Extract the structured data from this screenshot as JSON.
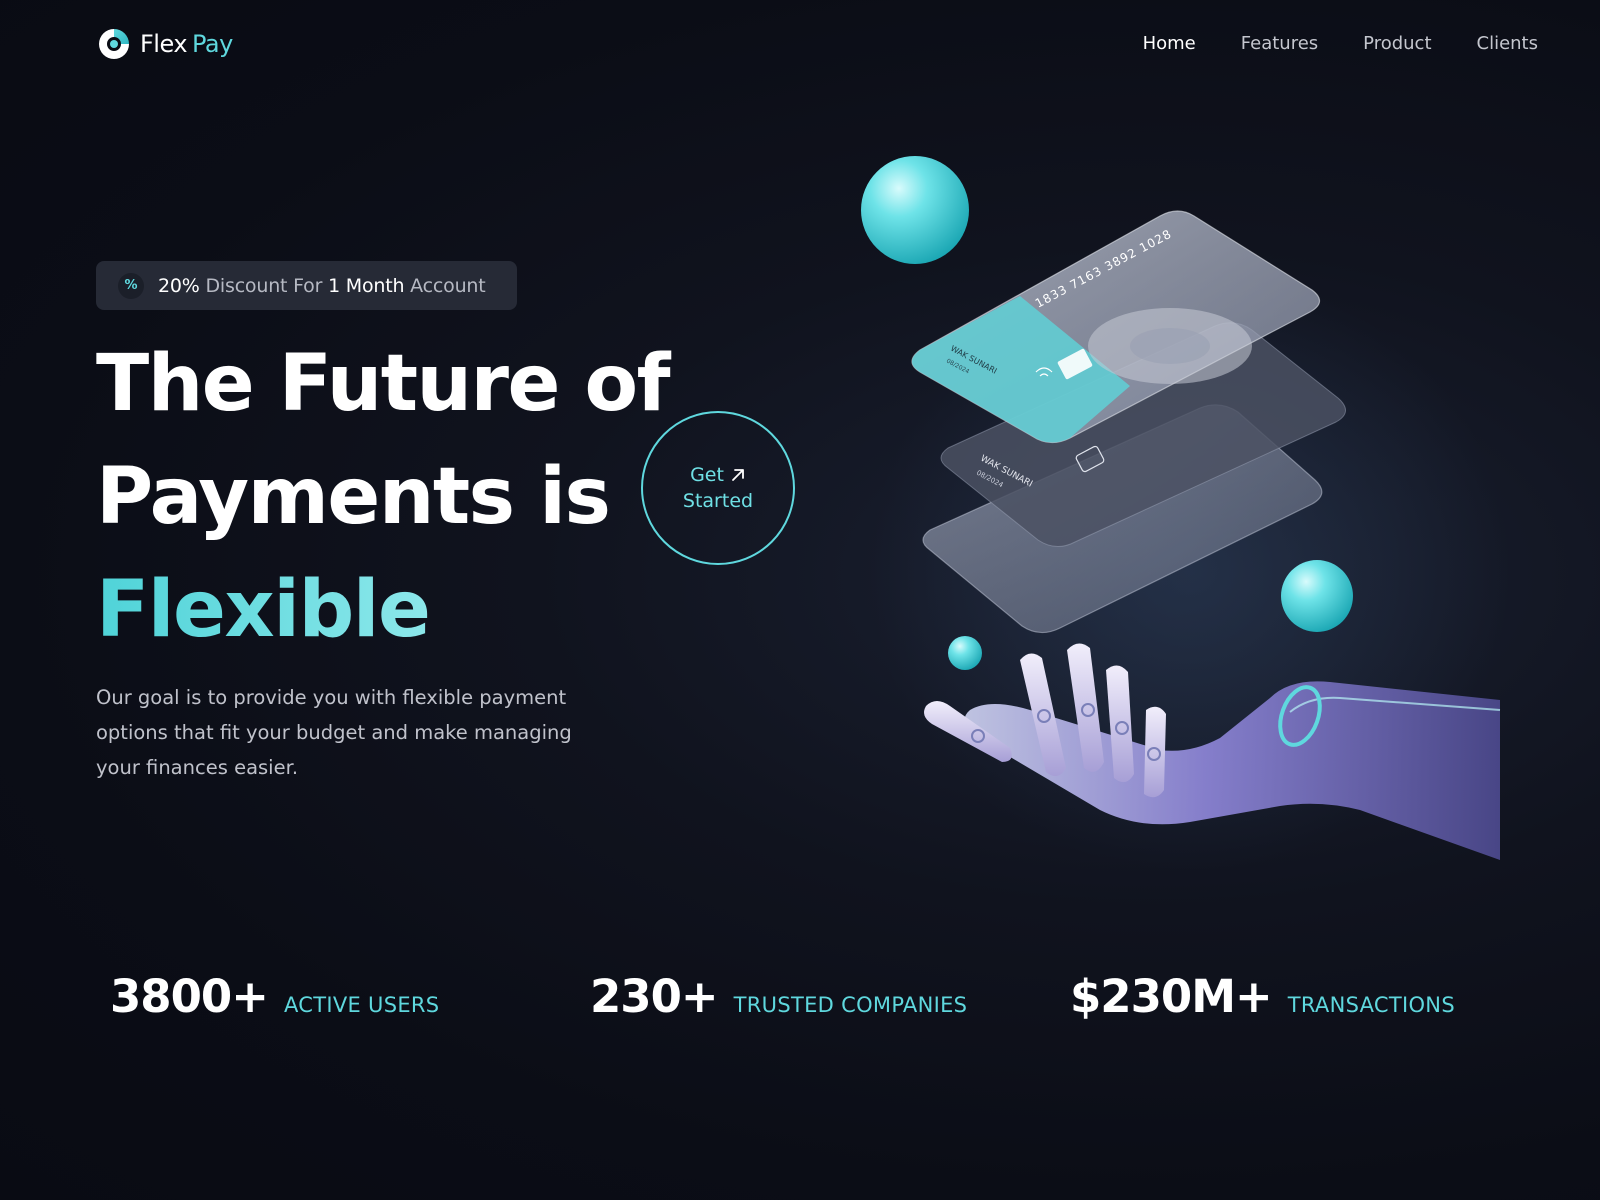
{
  "brand": {
    "name_part1": "Flex",
    "name_part2": "Pay"
  },
  "nav": {
    "items": [
      {
        "label": "Home",
        "active": true
      },
      {
        "label": "Features",
        "active": false
      },
      {
        "label": "Product",
        "active": false
      },
      {
        "label": "Clients",
        "active": false
      }
    ]
  },
  "badge": {
    "icon_glyph": "%",
    "text_parts": [
      "20%",
      " Discount For ",
      "1 Month",
      " Account"
    ]
  },
  "hero": {
    "headline_lines": [
      "The Future of",
      "Payments is",
      "Flexible"
    ],
    "cta_line1": "Get",
    "cta_line2": "Started",
    "description": "Our goal is to provide you with flexible payment options that fit your budget and make managing your finances easier."
  },
  "illustration": {
    "card_front_number": "1833 7163 3892 1028",
    "card_holder": "WAK SUNARI",
    "card_expiry": "08/2024"
  },
  "stats": [
    {
      "value": "3800+",
      "label": "ACTIVE USERS"
    },
    {
      "value": "230+",
      "label": "TRUSTED COMPANIES"
    },
    {
      "value": "$230M+",
      "label": "TRANSACTIONS"
    }
  ],
  "colors": {
    "accent": "#5fd8de",
    "background": "#0b0d16",
    "badge_bg": "#262a36",
    "text_muted": "#c0c2cb"
  },
  "icons": {
    "logo": "flexpay-logo-icon",
    "badge": "percent-icon",
    "cta": "arrow-up-right-icon"
  }
}
